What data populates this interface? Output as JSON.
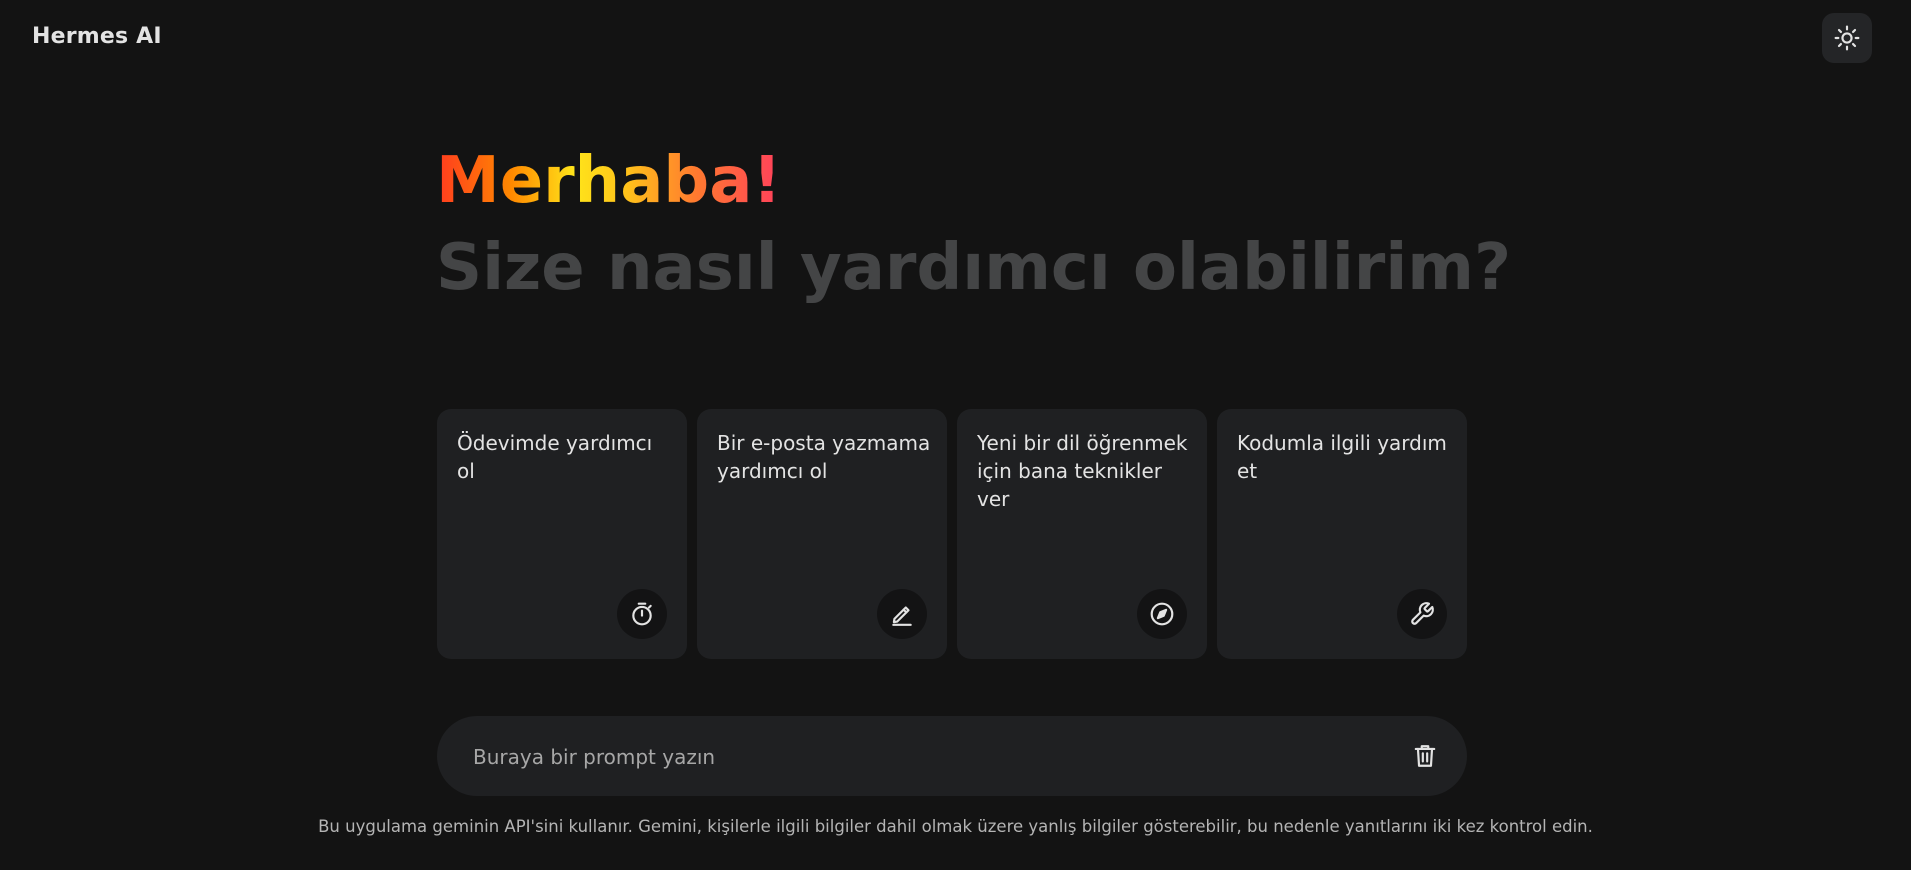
{
  "header": {
    "app_title": "Hermes AI",
    "theme_toggle_icon": "sun-icon"
  },
  "hero": {
    "greeting": "Merhaba!",
    "subtitle": "Size nasıl yardımcı olabilirim?"
  },
  "suggestions": [
    {
      "text": "Ödevimde yardımcı ol",
      "icon": "timer-icon"
    },
    {
      "text": "Bir e-posta yazmama yardımcı ol",
      "icon": "pencil-icon"
    },
    {
      "text": "Yeni bir dil öğrenmek için bana teknikler ver",
      "icon": "compass-icon"
    },
    {
      "text": "Kodumla ilgili yardım et",
      "icon": "wrench-icon"
    }
  ],
  "prompt": {
    "value": "",
    "placeholder": "Buraya bir prompt yazın",
    "delete_icon": "trash-icon"
  },
  "footer": {
    "disclaimer": "Bu uygulama geminin API'sini kullanır. Gemini, kişilerle ilgili bilgiler dahil olmak üzere yanlış bilgiler gösterebilir, bu nedenle yanıtlarını iki kez kontrol edin."
  },
  "colors": {
    "background": "#131313",
    "card": "#1f2022",
    "subtitle": "#444546",
    "greeting_gradient": [
      "#ff3b1f",
      "#ffe41a",
      "#ff3f5c"
    ]
  }
}
